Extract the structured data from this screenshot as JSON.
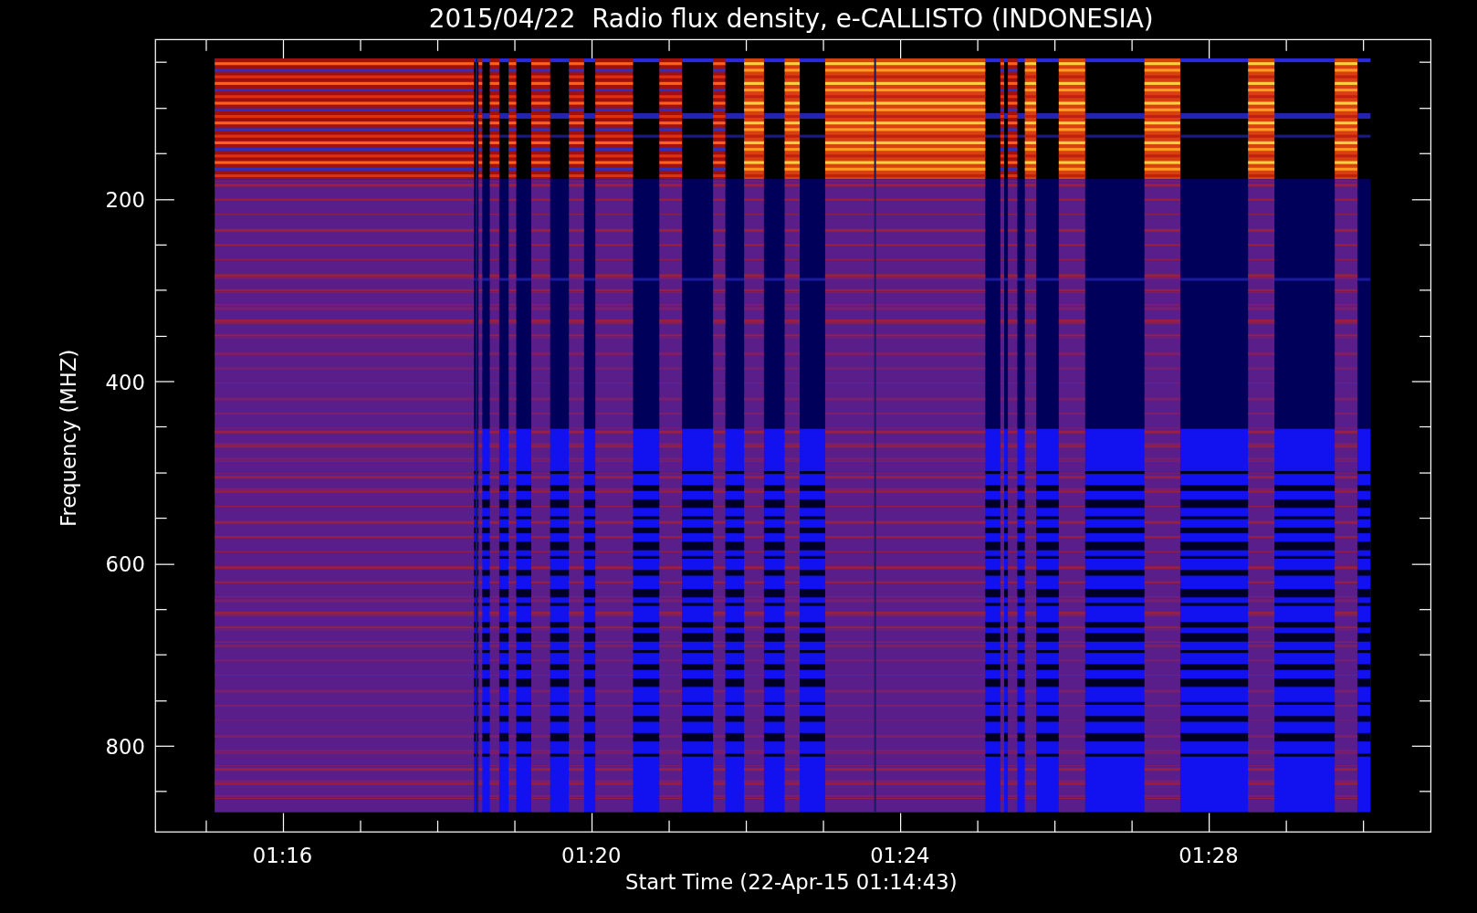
{
  "title": "2015/04/22  Radio flux density, e-CALLISTO (INDONESIA)",
  "y_axis": {
    "label": "Frequency (MHZ)",
    "ticks": [
      "200",
      "400",
      "600",
      "800"
    ]
  },
  "x_axis": {
    "label": "Start Time (22-Apr-15 01:14:43)",
    "ticks": [
      "01:16",
      "01:20",
      "01:24",
      "01:28"
    ]
  }
}
